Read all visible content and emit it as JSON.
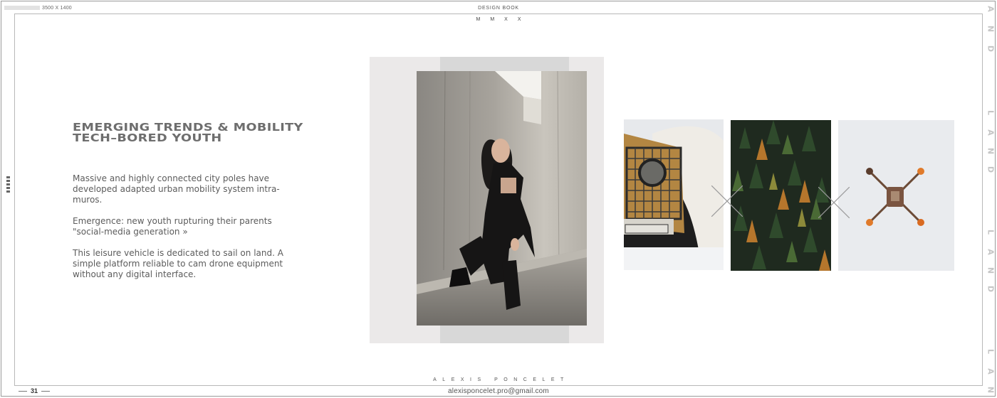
{
  "header": {
    "size_label": "3500 X 1400",
    "book_title": "DESIGN BOOK",
    "year": "MMXX"
  },
  "side_text": {
    "letters": [
      "A",
      "N",
      "D",
      "L",
      "A",
      "N",
      "D",
      "L",
      "A",
      "N",
      "D",
      "L",
      "A",
      "N"
    ]
  },
  "content": {
    "headline_line1": "EMERGING TRENDS & MOBILITY",
    "headline_line2": "TECH–BORED YOUTH",
    "paragraphs": [
      "Massive and highly connected city poles have developed adapted urban mobility system intra-muros.",
      "Emergence: new youth rupturing their parents \"social-media generation »",
      "This leisure vehicle is dedicated to sail on land. A simple platform reliable to cam drone equipment without any digital interface."
    ]
  },
  "images": {
    "main": "woman-sitting-on-concrete-ledge-photo",
    "thumbs": [
      "vintage-truck-in-snow-photo",
      "aerial-forest-photo",
      "drone-top-view-photo"
    ]
  },
  "footer": {
    "author": "ALEXIS PONCELET",
    "page_number": "31",
    "email": "alexisponcelet.pro@gmail.com"
  },
  "colors": {
    "frame": "#9a9a9a",
    "headline": "#6e6e6e",
    "body": "#5c5c5c",
    "side_letters": "#c6c6c6"
  }
}
